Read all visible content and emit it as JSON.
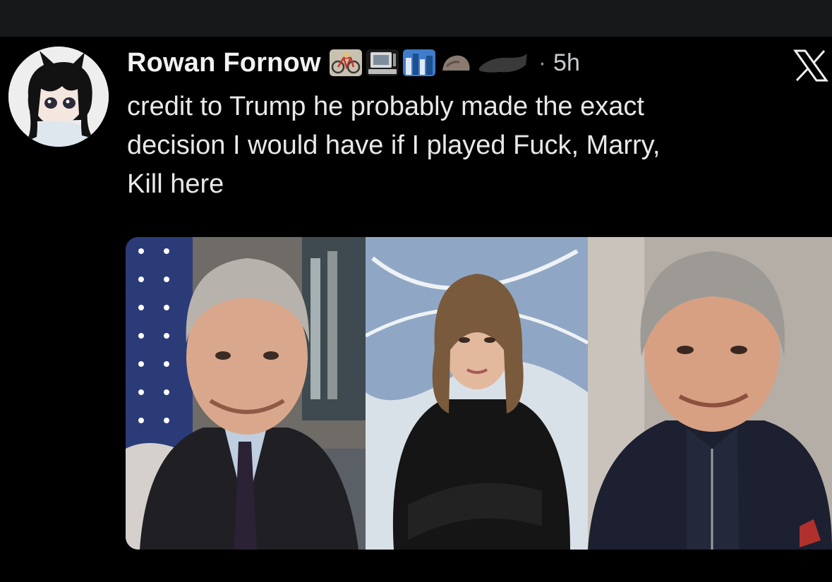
{
  "post": {
    "display_name": "Rowan Fornow",
    "separator": "·",
    "timestamp": "5h",
    "text": "credit to Trump he probably made the exact\ndecision I would have if I played Fuck, Marry,\nKill here",
    "badges": [
      "bicycle-emoji-icon",
      "computer-emoji-icon",
      "cityscape-emoji-icon",
      "rock-emoji-icon",
      "redacted-emoji-icon"
    ]
  },
  "brand": {
    "logo": "x-logo-icon"
  },
  "media": {
    "photos": [
      {
        "subject": "portrait-man-gray-hair-flag"
      },
      {
        "subject": "portrait-woman-black-suit"
      },
      {
        "subject": "portrait-man-gray-hair-sweater"
      }
    ]
  },
  "colors": {
    "background": "#000000",
    "top_band": "#17181a",
    "text": "#e8e8e8",
    "muted": "#8b9096"
  }
}
